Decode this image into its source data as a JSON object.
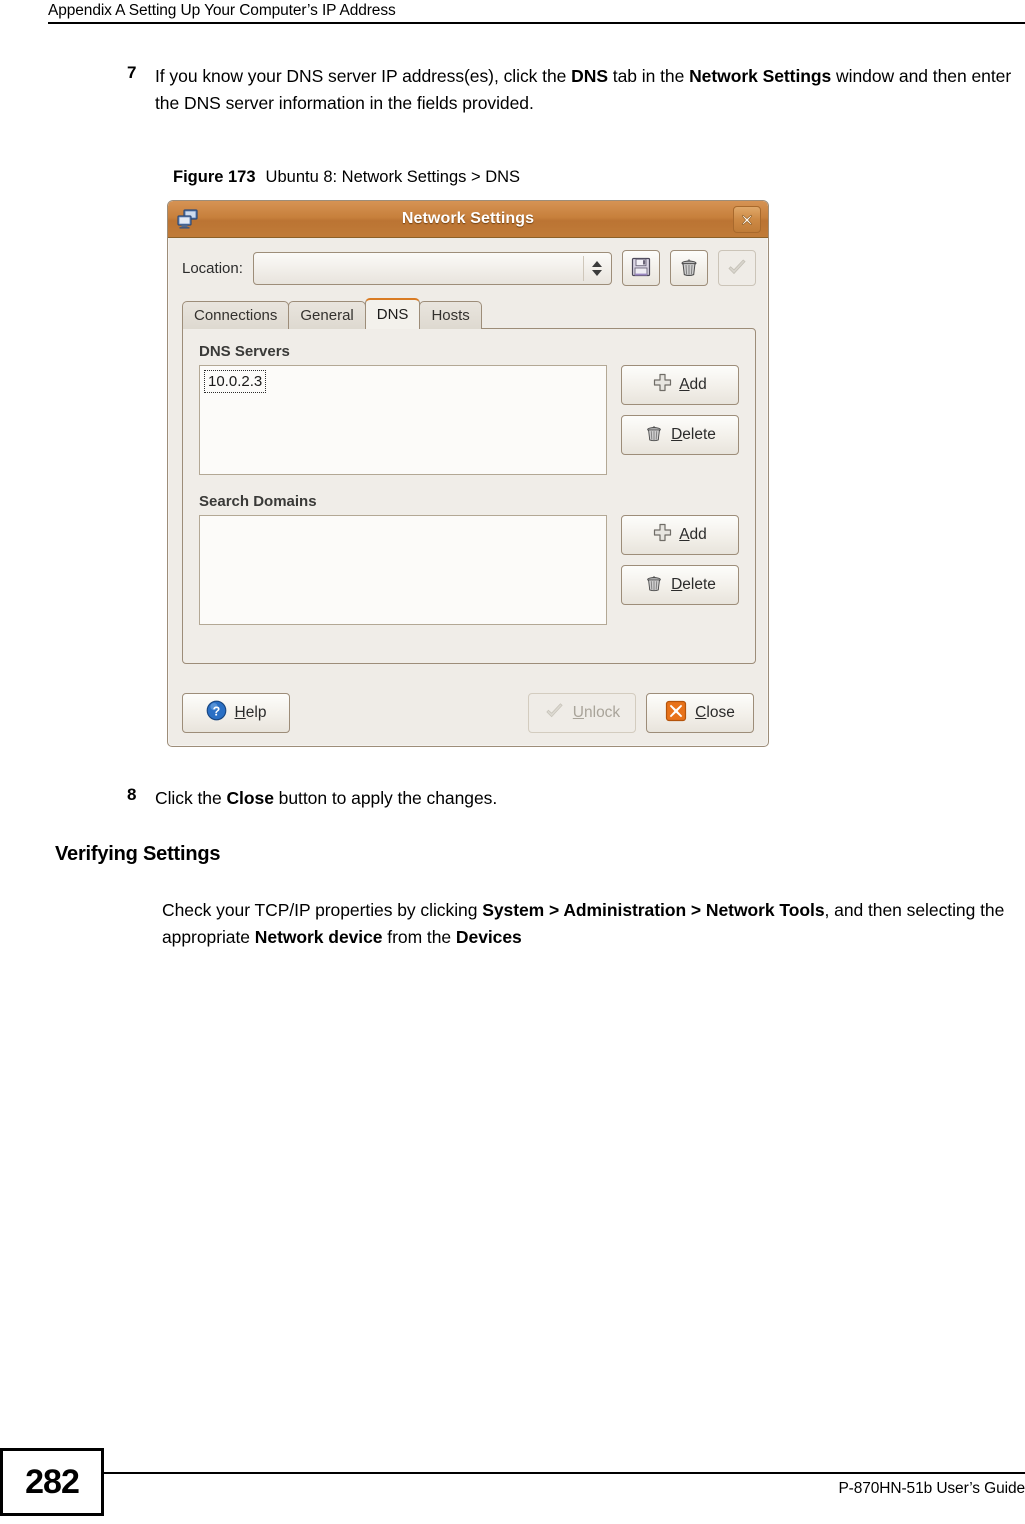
{
  "page": {
    "header_text": "Appendix A Setting Up Your Computer’s IP Address",
    "page_number": "282",
    "footer_right": "P-870HN-51b User’s Guide"
  },
  "steps": {
    "step7": {
      "number": "7",
      "text_parts": [
        {
          "t": "If you know your DNS server IP address(es), click the ",
          "b": false
        },
        {
          "t": "DNS",
          "b": true
        },
        {
          "t": " tab in the ",
          "b": false
        },
        {
          "t": "Network Settings",
          "b": true
        },
        {
          "t": " window and then enter the DNS server information in the fields provided.",
          "b": false
        }
      ]
    },
    "step8": {
      "number": "8",
      "text_parts": [
        {
          "t": "Click the ",
          "b": false
        },
        {
          "t": "Close",
          "b": true
        },
        {
          "t": " button to apply the changes.",
          "b": false
        }
      ]
    }
  },
  "figure": {
    "label": "Figure 173",
    "title": "Ubuntu 8: Network Settings > DNS"
  },
  "section": {
    "heading": "Verifying Settings",
    "paragraph_parts": [
      {
        "t": "Check your TCP/IP properties by clicking ",
        "b": false
      },
      {
        "t": "System > Administration > Network Tools",
        "b": true
      },
      {
        "t": ", and then selecting the appropriate ",
        "b": false
      },
      {
        "t": "Network device",
        "b": true
      },
      {
        "t": " from the ",
        "b": false
      },
      {
        "t": "Devices",
        "b": true
      }
    ]
  },
  "dialog": {
    "title": "Network Settings",
    "window_icon": "network-computers-icon",
    "titlebar_close_icon": "close-x-icon",
    "location": {
      "label": "Location:",
      "value": "",
      "placeholder": ""
    },
    "toolbar_buttons": [
      {
        "name": "save-location-button",
        "icon": "floppy-save-icon",
        "disabled": false
      },
      {
        "name": "delete-location-button",
        "icon": "trash-icon",
        "disabled": false
      },
      {
        "name": "apply-location-button",
        "icon": "checkmark-icon",
        "disabled": true
      }
    ],
    "tabs": [
      {
        "label": "Connections",
        "active": false
      },
      {
        "label": "General",
        "active": false
      },
      {
        "label": "DNS",
        "active": true
      },
      {
        "label": "Hosts",
        "active": false
      }
    ],
    "dns_servers": {
      "group_label": "DNS Servers",
      "items": [
        "10.0.2.3"
      ],
      "add_label": "Add",
      "add_mnemonic": "A",
      "delete_label": "Delete",
      "delete_mnemonic": "D"
    },
    "search_domains": {
      "group_label": "Search Domains",
      "items": [],
      "add_label": "Add",
      "add_mnemonic": "A",
      "delete_label": "Delete",
      "delete_mnemonic": "D"
    },
    "actions": {
      "help_label": "Help",
      "help_mnemonic": "H",
      "unlock_label": "Unlock",
      "unlock_mnemonic": "U",
      "unlock_disabled": true,
      "close_label": "Close",
      "close_mnemonic": "C"
    },
    "colors": {
      "titlebar_orange": "#c7803c",
      "active_tab_accent": "#d97b23",
      "close_icon_orange": "#e8721a",
      "help_icon_blue": "#2a6fc4",
      "dialog_bg": "#efece7",
      "panel_bg": "#f0ede8",
      "list_bg": "#fcfbf9"
    }
  }
}
